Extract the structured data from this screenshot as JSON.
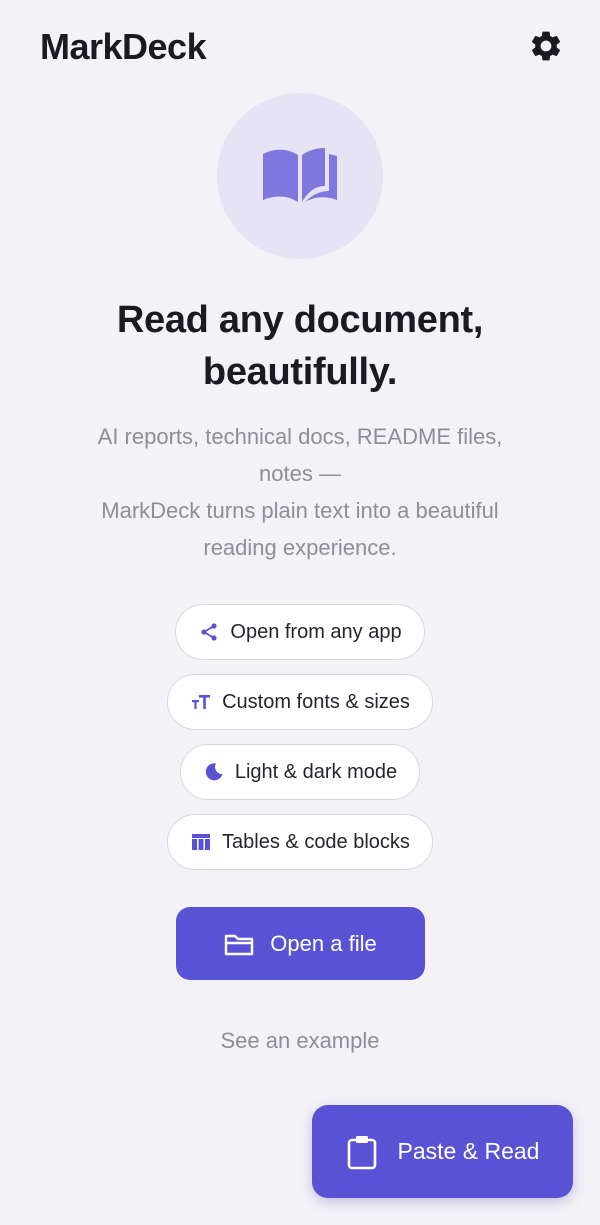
{
  "app": {
    "title": "MarkDeck"
  },
  "header": {
    "settings_icon": "gear-icon"
  },
  "hero": {
    "icon": "open-book-icon",
    "headline_line1": "Read any document,",
    "headline_line2": "beautifully.",
    "subtitle_line1": "AI reports, technical docs, README files,",
    "subtitle_line2": "notes —",
    "subtitle_line3": "MarkDeck turns plain text into a beautiful",
    "subtitle_line4": "reading experience."
  },
  "features": [
    {
      "label": "Open from any app",
      "icon": "share-icon"
    },
    {
      "label": "Custom fonts & sizes",
      "icon": "text-size-icon"
    },
    {
      "label": "Light & dark mode",
      "icon": "moon-icon"
    },
    {
      "label": "Tables & code blocks",
      "icon": "table-icon"
    }
  ],
  "actions": {
    "open_file_label": "Open a file",
    "open_file_icon": "folder-icon",
    "example_label": "See an example",
    "paste_label": "Paste & Read",
    "paste_icon": "clipboard-icon"
  },
  "colors": {
    "background": "#f3f2f7",
    "accent": "#5a52d5",
    "hero_circle": "#e6e4f4",
    "text_primary": "#1b1a20",
    "text_muted": "#8f8d96"
  }
}
